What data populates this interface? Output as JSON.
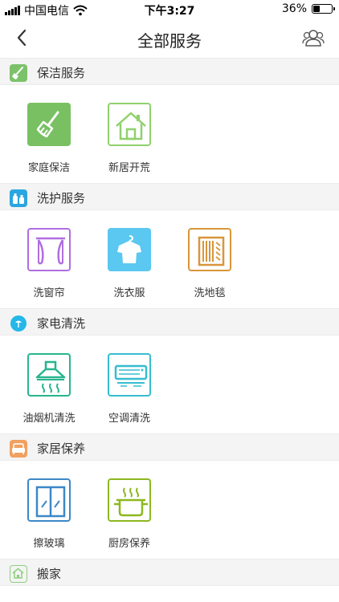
{
  "status_bar": {
    "carrier": "中国电信",
    "time": "下午3:27",
    "battery": "36%",
    "battery_level": 0.36
  },
  "nav": {
    "title": "全部服务",
    "back_icon": "chevron-left-icon",
    "users_icon": "users-icon"
  },
  "sections": [
    {
      "title": "保洁服务",
      "icon": "broom-icon",
      "color": "#7cc26a",
      "items": [
        {
          "label": "家庭保洁",
          "icon": "broom-icon",
          "color": "#79c062"
        },
        {
          "label": "新居开荒",
          "icon": "house-icon",
          "color": "#8fd16c"
        }
      ]
    },
    {
      "title": "洗护服务",
      "icon": "bottles-icon",
      "color": "#2aa6e0",
      "items": [
        {
          "label": "洗窗帘",
          "icon": "curtain-icon",
          "color": "#b06ee0"
        },
        {
          "label": "洗衣服",
          "icon": "shirt-icon",
          "color": "#5ac8f0"
        },
        {
          "label": "洗地毯",
          "icon": "carpet-icon",
          "color": "#d8963a"
        }
      ]
    },
    {
      "title": "家电清洗",
      "icon": "lamp-icon",
      "color": "#24b8e8",
      "items": [
        {
          "label": "油烟机清洗",
          "icon": "range-hood-icon",
          "color": "#27b58e"
        },
        {
          "label": "空调清洗",
          "icon": "air-conditioner-icon",
          "color": "#35bdd0"
        }
      ]
    },
    {
      "title": "家居保养",
      "icon": "sofa-icon",
      "color": "#f0a060",
      "items": [
        {
          "label": "擦玻璃",
          "icon": "window-icon",
          "color": "#3c88c8"
        },
        {
          "label": "厨房保养",
          "icon": "pot-icon",
          "color": "#8cb820"
        }
      ]
    },
    {
      "title": "搬家",
      "icon": "moving-house-icon",
      "color": "#8dcf7d",
      "items": []
    }
  ]
}
